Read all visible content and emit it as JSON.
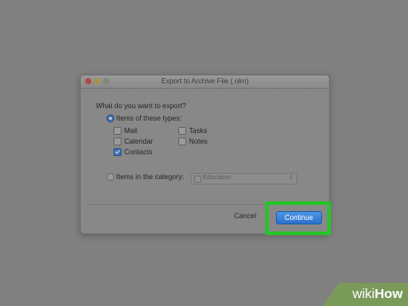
{
  "dialog": {
    "title": "Export to Archive File (.olm)",
    "question": "What do you want to export?",
    "option_types": {
      "label": "Items of these types:",
      "selected": true,
      "checkboxes": [
        {
          "label": "Mail",
          "checked": false
        },
        {
          "label": "Calendar",
          "checked": false
        },
        {
          "label": "Contacts",
          "checked": true
        },
        {
          "label": "Tasks",
          "checked": false
        },
        {
          "label": "Notes",
          "checked": false
        }
      ]
    },
    "option_category": {
      "label": "Items in the category:",
      "selected": false,
      "category_value": "Education"
    },
    "cancel_label": "Cancel",
    "continue_label": "Continue"
  },
  "watermark": {
    "prefix": "wiki",
    "suffix": "How"
  },
  "colors": {
    "accent": "#3f6fb0",
    "highlight": "#26c426",
    "continue_button": "#2c72cc",
    "watermark_bg": "#7a9a5a"
  }
}
